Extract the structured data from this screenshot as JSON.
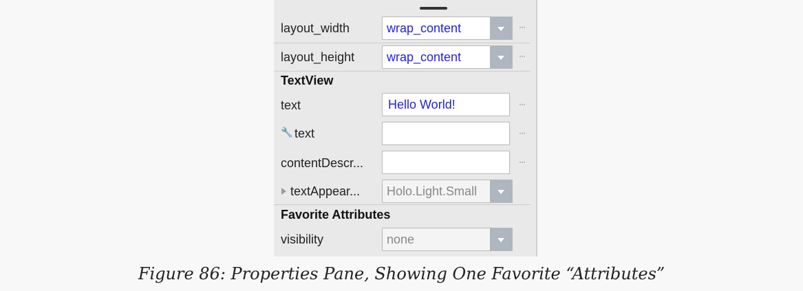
{
  "properties": {
    "rows": [
      {
        "label": "layout_width",
        "value": "wrap_content",
        "more": "···"
      },
      {
        "label": "layout_height",
        "value": "wrap_content",
        "more": "···"
      }
    ],
    "section_textview": "TextView",
    "textview_rows": [
      {
        "label": "text",
        "value": "Hello World!",
        "more": "···"
      },
      {
        "label": "text",
        "value": "",
        "more": "···"
      },
      {
        "label": "contentDescr...",
        "value": "",
        "more": "···"
      },
      {
        "label": "textAppear...",
        "value": "Holo.Light.Small"
      }
    ],
    "section_favorites": "Favorite Attributes",
    "favorite_rows": [
      {
        "label": "visibility",
        "value": "none"
      }
    ]
  },
  "icons": {
    "wrench": "wrench-icon",
    "expand": "expand-triangle-icon",
    "dropdown": "chevron-down-icon"
  },
  "caption": "Figure 86: Properties Pane, Showing One Favorite “Attributes”"
}
